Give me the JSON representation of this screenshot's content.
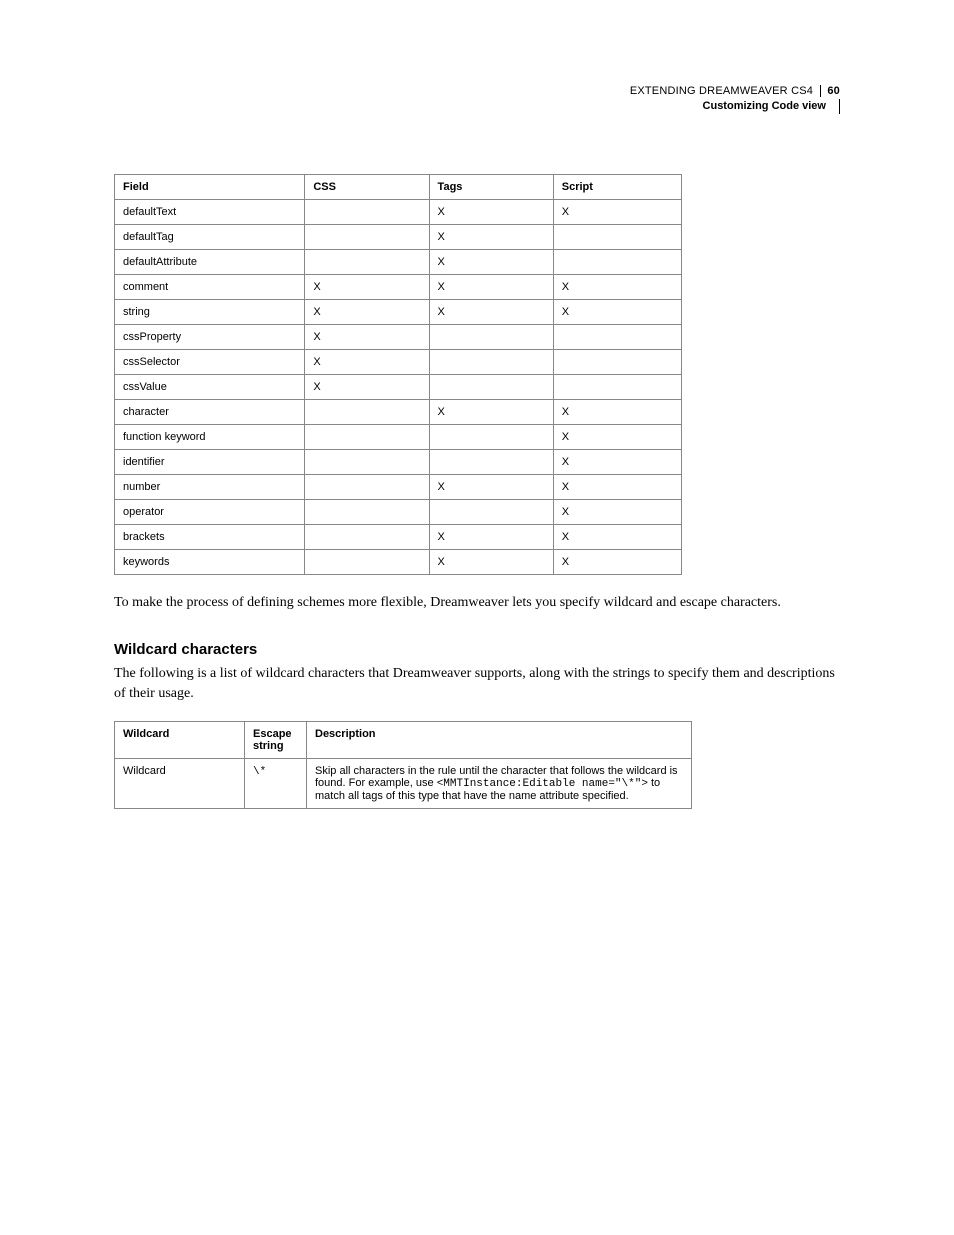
{
  "header": {
    "doc_title": "EXTENDING DREAMWEAVER CS4",
    "page_number": "60",
    "section": "Customizing Code view"
  },
  "fields_table": {
    "headers": {
      "field": "Field",
      "css": "CSS",
      "tags": "Tags",
      "script": "Script"
    },
    "rows": [
      {
        "field": "defaultText",
        "css": "",
        "tags": "X",
        "script": "X"
      },
      {
        "field": "defaultTag",
        "css": "",
        "tags": "X",
        "script": ""
      },
      {
        "field": "defaultAttribute",
        "css": "",
        "tags": "X",
        "script": ""
      },
      {
        "field": "comment",
        "css": "X",
        "tags": "X",
        "script": "X"
      },
      {
        "field": "string",
        "css": "X",
        "tags": "X",
        "script": "X"
      },
      {
        "field": "cssProperty",
        "css": "X",
        "tags": "",
        "script": ""
      },
      {
        "field": "cssSelector",
        "css": "X",
        "tags": "",
        "script": ""
      },
      {
        "field": "cssValue",
        "css": "X",
        "tags": "",
        "script": ""
      },
      {
        "field": "character",
        "css": "",
        "tags": "X",
        "script": "X"
      },
      {
        "field": "function keyword",
        "css": "",
        "tags": "",
        "script": "X"
      },
      {
        "field": "identifier",
        "css": "",
        "tags": "",
        "script": "X"
      },
      {
        "field": "number",
        "css": "",
        "tags": "X",
        "script": "X"
      },
      {
        "field": "operator",
        "css": "",
        "tags": "",
        "script": "X"
      },
      {
        "field": "brackets",
        "css": "",
        "tags": "X",
        "script": "X"
      },
      {
        "field": "keywords",
        "css": "",
        "tags": "X",
        "script": "X"
      }
    ]
  },
  "para_after_table": "To make the process of defining schemes more flexible, Dreamweaver lets you specify wildcard and escape characters.",
  "wildcard_section": {
    "heading": "Wildcard characters",
    "intro": "The following is a list of wildcard characters that Dreamweaver supports, along with the strings to specify them and descriptions of their usage.",
    "headers": {
      "wildcard": "Wildcard",
      "escape": "Escape string",
      "description": "Description"
    },
    "rows": [
      {
        "wildcard": "Wildcard",
        "escape": "\\*",
        "desc_pre": "Skip all characters in the rule until the character that follows the wildcard is found. For example, use ",
        "desc_code": "<MMTInstance:Editable name=\"\\*\">",
        "desc_post": " to match all tags of this type that have the name attribute specified."
      }
    ]
  }
}
